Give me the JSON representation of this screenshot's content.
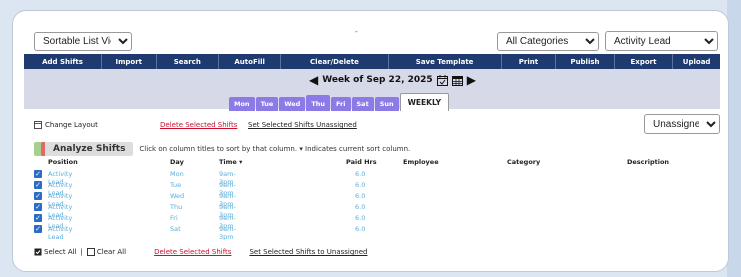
{
  "top": {
    "dash": "-",
    "view_select": "Sortable List View",
    "category_select": "All Categories",
    "position_select": "Activity Lead"
  },
  "navbar": [
    "Add Shifts",
    "Import",
    "Search",
    "AutoFill",
    "Clear/Delete",
    "Save Template",
    "Print",
    "Publish",
    "Export",
    "Upload"
  ],
  "week": {
    "label": "Week of Sep 22, 2025"
  },
  "tabs": [
    "Mon",
    "Tue",
    "Wed",
    "Thu",
    "Fri",
    "Sat",
    "Sun"
  ],
  "tab_active": "Thu",
  "weekly_tab": "WEEKLY",
  "toolbar": {
    "change_layout": "Change Layout",
    "delete_selected": "Delete Selected Shifts",
    "set_unassigned": "Set Selected Shifts Unassigned",
    "assign_select": "Unassigned"
  },
  "analyze": {
    "button": "Analyze Shifts",
    "instructions": "Click on column titles to sort by that column.  ▾ Indicates current sort column."
  },
  "table": {
    "headers": [
      "Position",
      "Day",
      "Time ▾",
      "Paid Hrs",
      "Employee",
      "Category",
      "Description"
    ],
    "rows": [
      [
        "Activity Lead",
        "Mon",
        "9am-3pm",
        "6.0"
      ],
      [
        "Activity Lead",
        "Tue",
        "9am-3pm",
        "6.0"
      ],
      [
        "Activity Lead",
        "Wed",
        "9am-3pm",
        "6.0"
      ],
      [
        "Activity Lead",
        "Thu",
        "9am-3pm",
        "6.0"
      ],
      [
        "Activity Lead",
        "Fri",
        "9am-3pm",
        "6.0"
      ],
      [
        "Activity Lead",
        "Sat",
        "9am-3pm",
        "6.0"
      ]
    ]
  },
  "bottom": {
    "select_all": "Select All",
    "separator": "|",
    "clear_all": "Clear All",
    "delete_selected": "Delete Selected Shifts",
    "set_unassigned": "Set Selected Shifts to Unassigned"
  },
  "colors": {
    "navbar": "#1f3a6e",
    "tab": "#8c7be6",
    "link_red": "#c8102e",
    "row_text": "#5aaedb",
    "highlight": "#f0e600"
  },
  "icons": [
    "calendar-check-icon",
    "calendar-grid-icon",
    "arrow-left-icon",
    "arrow-right-icon",
    "layout-icon",
    "checkbox-icon"
  ]
}
